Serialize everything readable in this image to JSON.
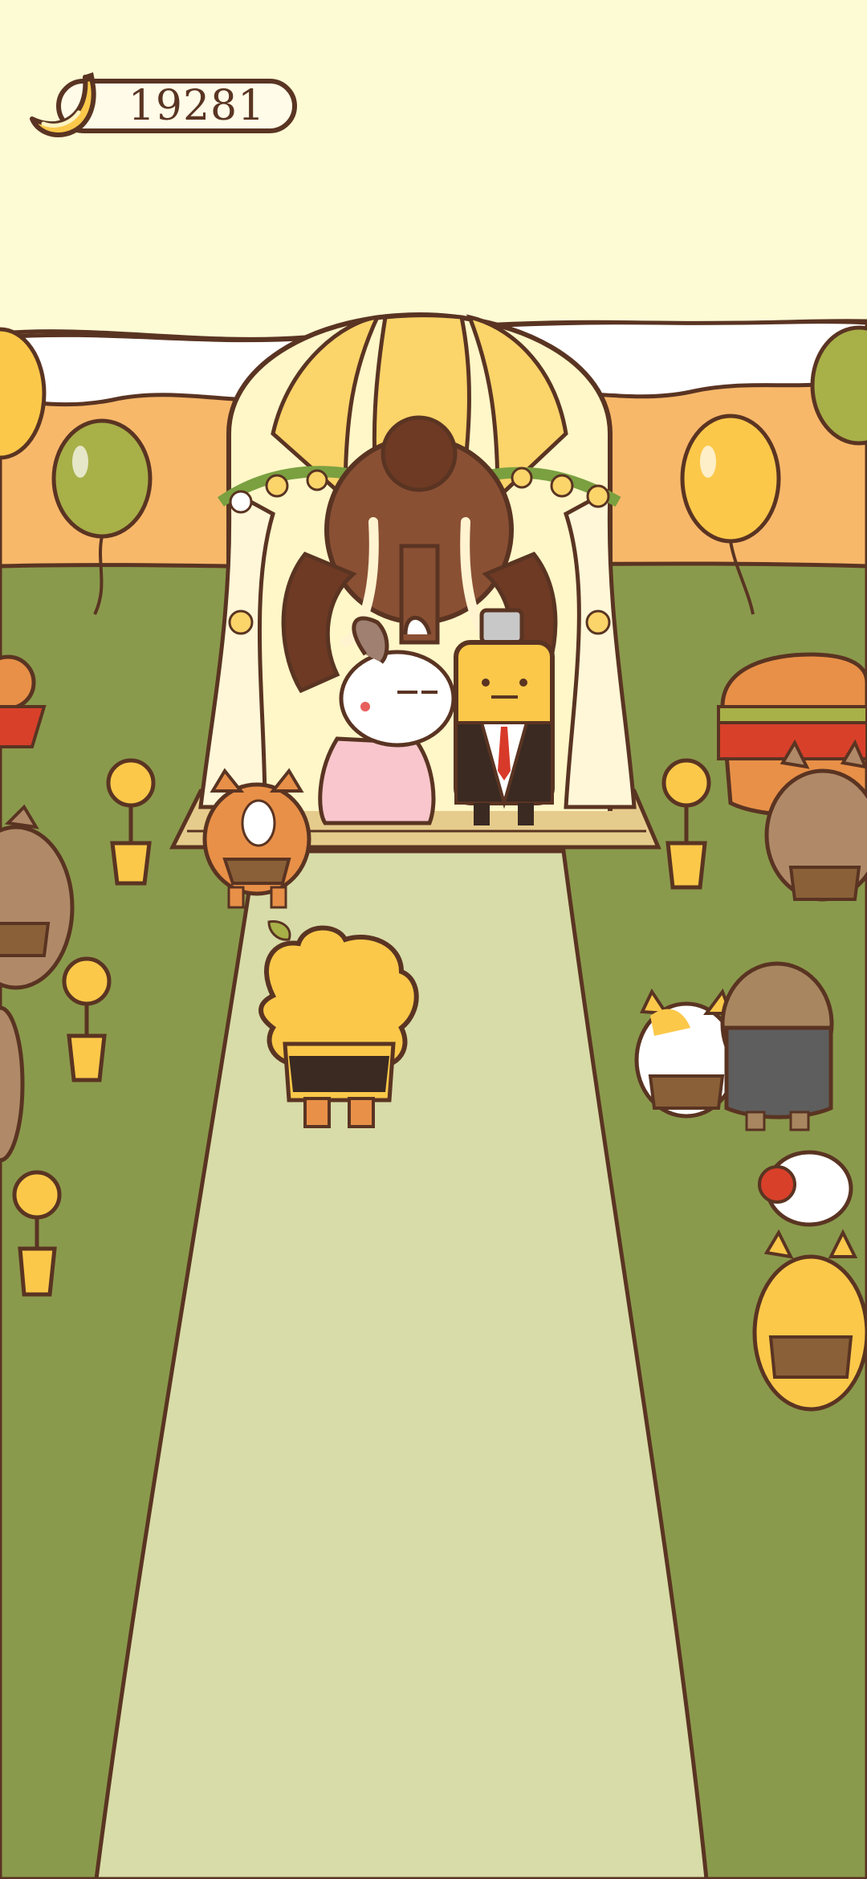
{
  "hud": {
    "currency_icon": "banana-icon",
    "currency_value": "19281"
  },
  "colors": {
    "sky": "#fdfbd4",
    "grass": "#8a9a4c",
    "aisle": "#d8dca8",
    "outline": "#5a3422",
    "hills": "#f8b86a",
    "balloon_yellow": "#fbc84a",
    "balloon_green": "#a8b048"
  },
  "scene": {
    "type": "wedding-ceremony",
    "characters": [
      "mammoth-officiant",
      "bunny-bride",
      "battery-groom",
      "tiger-cat-guest",
      "lion-guest",
      "burger-guest",
      "calico-cat-guest",
      "mole-guest",
      "tabby-cat-guests",
      "orange-cat-guest"
    ]
  }
}
